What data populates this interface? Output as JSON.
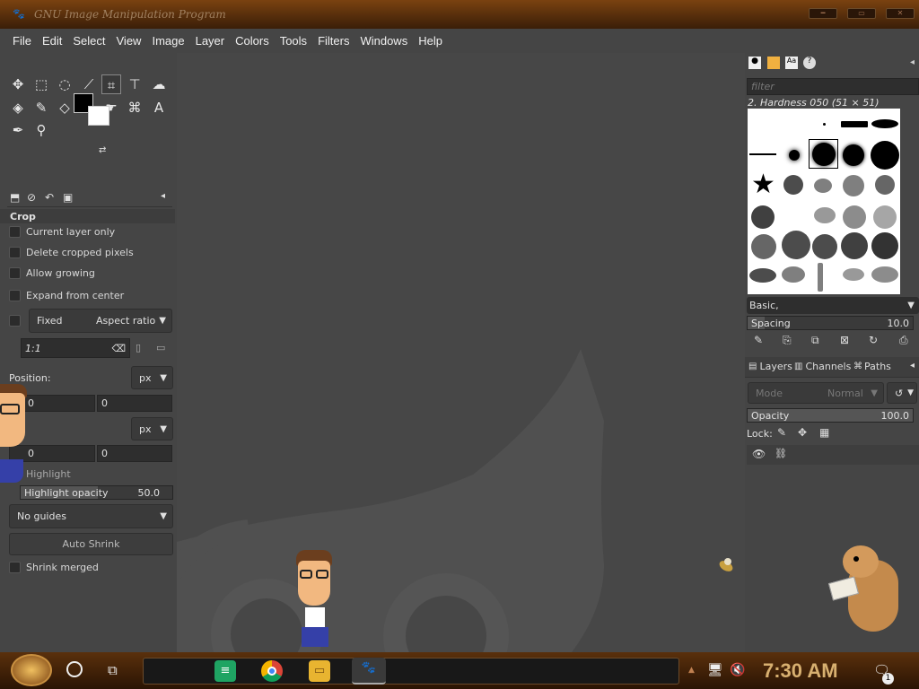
{
  "window": {
    "title": "GNU Image Manipulation Program"
  },
  "menu": [
    "File",
    "Edit",
    "Select",
    "View",
    "Image",
    "Layer",
    "Colors",
    "Tools",
    "Filters",
    "Windows",
    "Help"
  ],
  "tool_options": {
    "title": "Crop",
    "current_layer_only": "Current layer only",
    "delete_cropped": "Delete cropped pixels",
    "allow_growing": "Allow growing",
    "expand_center": "Expand from center",
    "fixed": "Fixed",
    "aspect": "Aspect ratio",
    "ratio_value": "1:1",
    "position_label": "Position:",
    "unit": "px",
    "pos_x": "0",
    "pos_y": "0",
    "size_unit": "px",
    "size_x": "0",
    "size_y": "0",
    "highlight": "Highlight",
    "highlight_opacity": "Highlight opacity",
    "highlight_value": "50.0",
    "guides": "No guides",
    "auto_shrink": "Auto Shrink",
    "shrink_merged": "Shrink merged"
  },
  "brushes": {
    "filter_placeholder": "filter",
    "current": "2. Hardness 050 (51 × 51)",
    "tag": "Basic,",
    "spacing_label": "Spacing",
    "spacing_value": "10.0"
  },
  "layers": {
    "tab_layers": "Layers",
    "tab_channels": "Channels",
    "tab_paths": "Paths",
    "mode_label": "Mode",
    "mode_value": "Normal",
    "opacity_label": "Opacity",
    "opacity_value": "100.0",
    "lock_label": "Lock:"
  },
  "taskbar": {
    "time": "7:30 AM",
    "notif_count": "1"
  }
}
